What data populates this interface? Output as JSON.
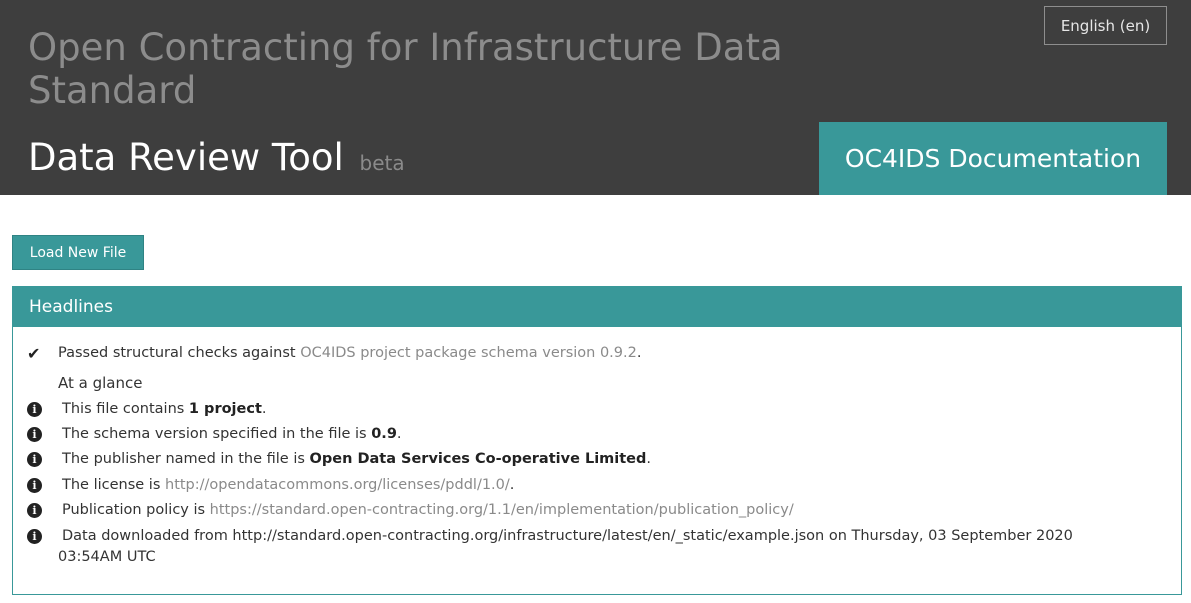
{
  "header": {
    "language_label": "English (en)",
    "site_title": "Open Contracting for Infrastructure Data Standard",
    "tool_title": "Data Review Tool",
    "tool_badge": "beta",
    "docs_button": "OC4IDS Documentation"
  },
  "toolbar": {
    "load_button": "Load New File"
  },
  "headlines": {
    "title": "Headlines",
    "passed": {
      "prefix": "Passed structural checks against ",
      "link": "OC4IDS project package schema version 0.9.2",
      "suffix": "."
    },
    "glance_title": "At a glance",
    "items": [
      {
        "prefix": "This file contains ",
        "strong": "1 project",
        "suffix": "."
      },
      {
        "prefix": "The schema version specified in the file is ",
        "strong": "0.9",
        "suffix": "."
      },
      {
        "prefix": "The publisher named in the file is ",
        "strong": "Open Data Services Co-operative Limited",
        "suffix": "."
      },
      {
        "prefix": "The license is ",
        "link": "http://opendatacommons.org/licenses/pddl/1.0/",
        "suffix": "."
      },
      {
        "prefix": "Publication policy is ",
        "link": "https://standard.open-contracting.org/1.1/en/implementation/publication_policy/",
        "suffix": ""
      },
      {
        "line1": "Data downloaded from http://standard.open-contracting.org/infrastructure/latest/en/_static/example.json on Thursday, 03 September 2020",
        "line2": "03:54AM UTC"
      }
    ]
  },
  "icons": {
    "check": "check-icon",
    "info": "info-circle-icon"
  },
  "colors": {
    "header_bg": "#3e3e3e",
    "accent": "#399899"
  }
}
